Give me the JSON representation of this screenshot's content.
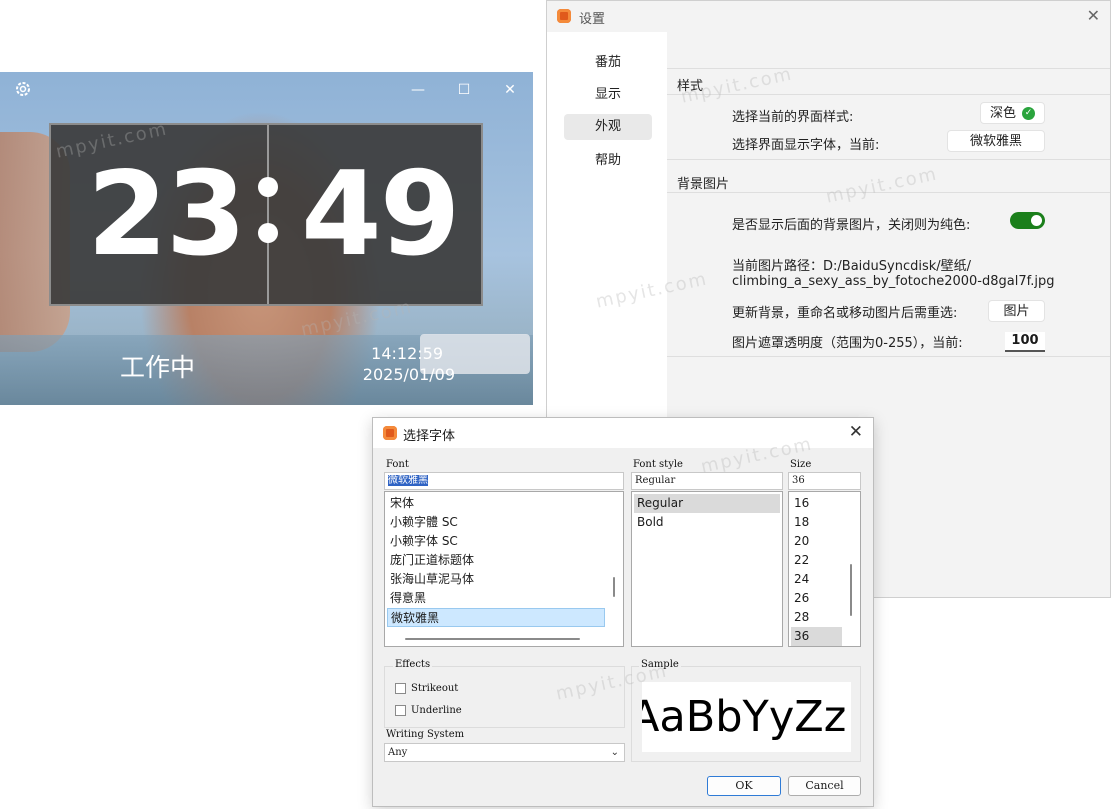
{
  "clock": {
    "settings_icon": "gear-icon",
    "minimize_icon": "—",
    "maximize_icon": "☐",
    "close_icon": "✕",
    "hours": "23",
    "minutes": "49",
    "status": "工作中",
    "time": "14:12:59",
    "date": "2025/01/09"
  },
  "settings": {
    "title": "设置",
    "close": "✕",
    "nav": [
      "番茄",
      "显示",
      "外观",
      "帮助"
    ],
    "active_nav": "外观",
    "style_section": "样式",
    "theme_label": "选择当前的界面样式:",
    "theme_value": "深色",
    "font_label": "选择界面显示字体，当前:",
    "font_value": "微软雅黑",
    "bg_section": "背景图片",
    "bg_toggle_label": "是否显示后面的背景图片，关闭则为纯色:",
    "bg_toggle_on": true,
    "bg_path_line1": "当前图片路径：D:/BaiduSyncdisk/壁纸/",
    "bg_path_line2": "climbing_a_sexy_ass_by_fotoche2000-d8gal7f.jpg",
    "bg_update_label": "更新背景，重命名或移动图片后需重选:",
    "bg_update_button": "图片",
    "opacity_label": "图片遮罩透明度（范围为0-255），当前:",
    "opacity_value": "100"
  },
  "font_dialog": {
    "title": "选择字体",
    "close": "✕",
    "font_label": "Font",
    "font_value": "微软雅黑",
    "fonts": [
      "宋体",
      "小赖字體 SC",
      "小赖字体 SC",
      "庞门正道标题体",
      "张海山草泥马体",
      "得意黑",
      "微软雅黑"
    ],
    "selected_font": "微软雅黑",
    "style_label": "Font style",
    "style_value": "Regular",
    "styles": [
      "Regular",
      "Bold"
    ],
    "size_label": "Size",
    "size_value": "36",
    "sizes": [
      "16",
      "18",
      "20",
      "22",
      "24",
      "26",
      "28",
      "36"
    ],
    "effects_label": "Effects",
    "strikeout_label": "Strikeout",
    "underline_label": "Underline",
    "writing_system_label": "Writing System",
    "writing_system_value": "Any",
    "sample_label": "Sample",
    "sample_text": "AaBbYyZz",
    "ok": "OK",
    "cancel": "Cancel"
  },
  "watermark": "mpyit.com"
}
